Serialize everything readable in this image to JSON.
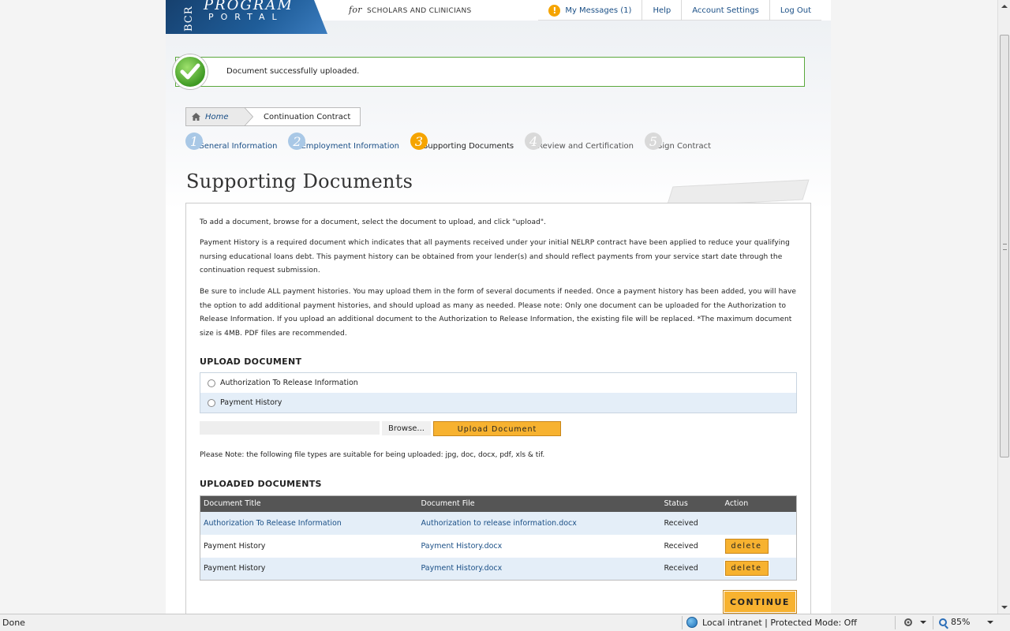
{
  "header": {
    "logo_bcr": "BCR",
    "logo_program": "PROGRAM",
    "logo_portal": "PORTAL",
    "tagline_for": "for",
    "tagline": "SCHOLARS AND CLINICIANS",
    "nav": {
      "messages": "My Messages (1)",
      "help": "Help",
      "account_settings": "Account Settings",
      "logout": "Log Out"
    }
  },
  "banner": {
    "text": "Document successfully uploaded."
  },
  "breadcrumb": {
    "home": "Home",
    "current": "Continuation Contract"
  },
  "steps": [
    {
      "num": "1",
      "label": "General Information",
      "state": "done"
    },
    {
      "num": "2",
      "label": "Employment Information",
      "state": "done"
    },
    {
      "num": "3",
      "label": "Supporting Documents",
      "state": "active"
    },
    {
      "num": "4",
      "label": "Review and Certification",
      "state": "todo"
    },
    {
      "num": "5",
      "label": "Sign Contract",
      "state": "todo"
    }
  ],
  "page_title": "Supporting Documents",
  "instructions": {
    "p1": "To add a document, browse for a document, select the document to upload, and click \"upload\".",
    "p2": "Payment History is a required document which indicates that all payments received under your initial NELRP contract have been applied to reduce your qualifying nursing educational loans debt. This payment history can be obtained from your lender(s) and should reflect payments from your service start date through the continuation request submission.",
    "p3": "Be sure to include ALL payment histories. You may upload them in the form of several documents if needed. Once a payment history has been added, you will have the option to add additional payment histories, and should upload as many as needed. Please note: Only one document can be uploaded for the Authorization to Release Information. If you upload an additional document to the Authorization to Release Information, the existing file will be replaced. *The maximum document size is 4MB. PDF files are recommended."
  },
  "upload": {
    "title": "UPLOAD DOCUMENT",
    "options": [
      "Authorization To Release Information",
      "Payment History"
    ],
    "browse": "Browse...",
    "upload_button": "Upload Document",
    "note": "Please Note: the following file types are suitable for being uploaded: jpg, doc, docx, pdf, xls & tif."
  },
  "uploaded": {
    "title": "UPLOADED DOCUMENTS",
    "columns": [
      "Document Title",
      "Document File",
      "Status",
      "Action"
    ],
    "rows": [
      {
        "title": "Authorization To Release Information",
        "file": "Authorization to release information.docx",
        "status": "Received",
        "action": ""
      },
      {
        "title": "Payment History",
        "file": "Payment History.docx",
        "status": "Received",
        "action": "delete"
      },
      {
        "title": "Payment History",
        "file": "Payment History.docx",
        "status": "Received",
        "action": "delete"
      }
    ]
  },
  "continue_button": "CONTINUE",
  "statusbar": {
    "done": "Done",
    "zone": "Local intranet | Protected Mode: Off",
    "zoom": "85%"
  },
  "colors": {
    "accent_orange": "#f7b230",
    "link_blue": "#1a4f86",
    "success_green": "#5aa83c",
    "table_header": "#555555",
    "row_alt": "#e4eef8"
  }
}
